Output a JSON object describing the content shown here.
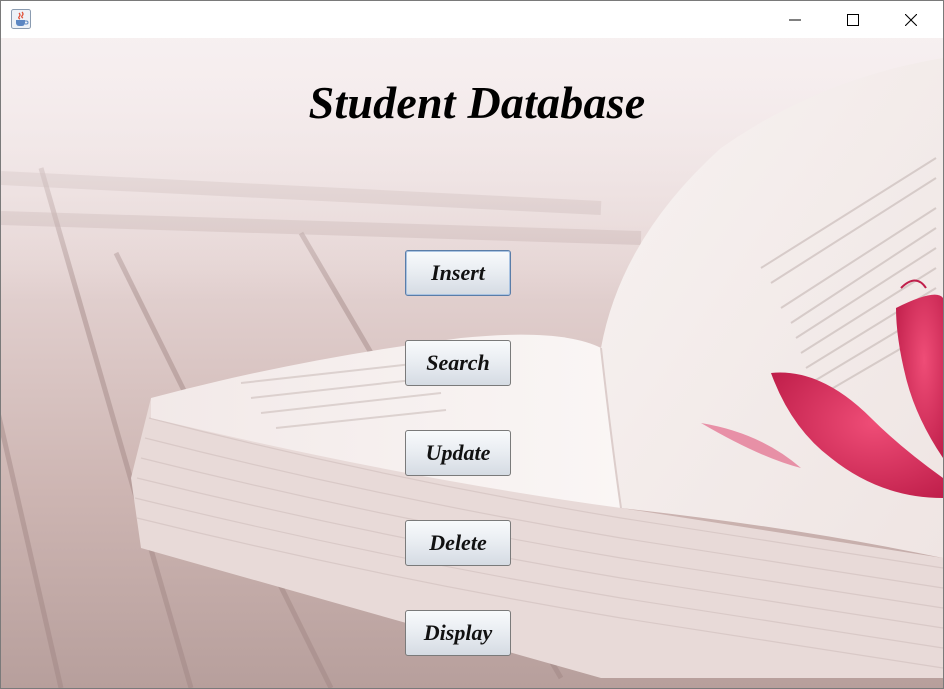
{
  "window": {
    "app_icon": "java-cup-icon",
    "controls": {
      "minimize": "minimize-icon",
      "maximize": "maximize-icon",
      "close": "close-icon"
    }
  },
  "main": {
    "title": "Student Database",
    "buttons": [
      {
        "label": "Insert"
      },
      {
        "label": "Search"
      },
      {
        "label": "Update"
      },
      {
        "label": "Delete"
      },
      {
        "label": "Display"
      }
    ]
  },
  "colors": {
    "title_text": "#000000",
    "petal": "#d82d5e",
    "wood": "#cdb7b4"
  }
}
